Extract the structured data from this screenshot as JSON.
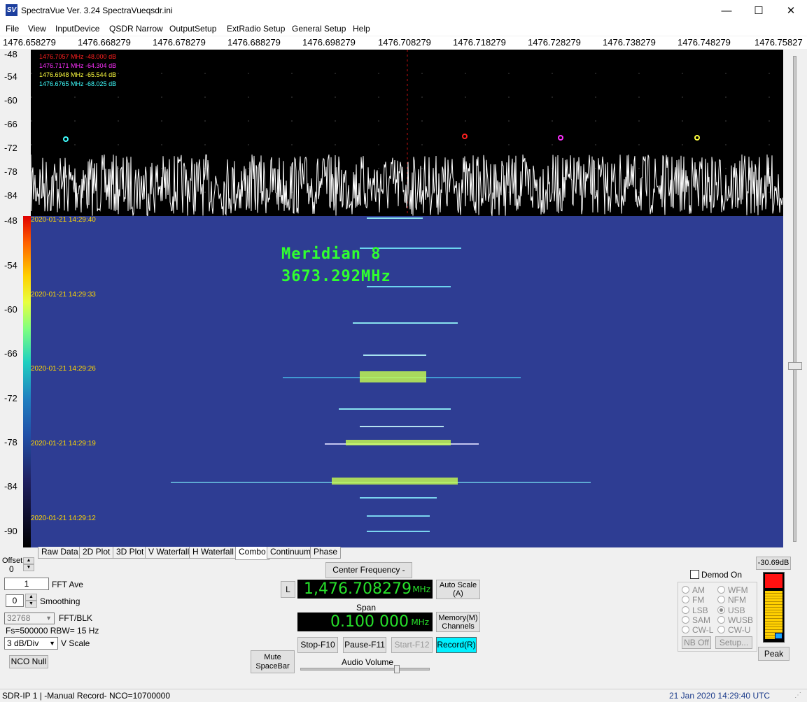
{
  "window": {
    "icon_text": "SV",
    "title": "SpectraVue Ver. 3.24  SpectraVueqsdr.ini",
    "minimize": "—",
    "maximize": "☐",
    "close": "✕"
  },
  "menu": [
    "File",
    "View",
    "InputDevice",
    "QSDR Narrow",
    "OutputSetup",
    "ExtRadio Setup",
    "General Setup",
    "Help"
  ],
  "freq_scale": [
    "1476.658279",
    "1476.668279",
    "1476.678279",
    "1476.688279",
    "1476.698279",
    "1476.708279",
    "1476.718279",
    "1476.728279",
    "1476.738279",
    "1476.748279",
    "1476.75827"
  ],
  "spectrum": {
    "y_labels": [
      "-48",
      "-54",
      "-60",
      "-66",
      "-72",
      "-78",
      "-84"
    ],
    "markers": [
      {
        "text": "1476.7057 MHz -48.000 dB",
        "color": "#ff2020"
      },
      {
        "text": "1476.7171 MHz -64.304 dB",
        "color": "#ff30ff"
      },
      {
        "text": "1476.6948 MHz -65.544 dB",
        "color": "#ffff40"
      },
      {
        "text": "1476.6765 MHz -68.025 dB",
        "color": "#40ffff"
      }
    ]
  },
  "waterfall": {
    "y_labels": [
      "-48",
      "-54",
      "-60",
      "-66",
      "-72",
      "-78",
      "-84",
      "-90"
    ],
    "timestamps": [
      "2020-01-21 14:29:40",
      "2020-01-21 14:29:33",
      "2020-01-21 14:29:26",
      "2020-01-21 14:29:19",
      "2020-01-21 14:29:12"
    ],
    "overlay_line1": "Meridian 8",
    "overlay_line2": "3673.292MHz"
  },
  "tabs": [
    "Raw Data",
    "2D Plot",
    "3D Plot",
    "V Waterfall",
    "H Waterfall",
    "Combo",
    "Continuum",
    "Phase"
  ],
  "controls": {
    "offset_label": "Offset",
    "offset_value": "0",
    "fft_ave_value": "1",
    "fft_ave_label": "FFT Ave",
    "smoothing_value": "0",
    "smoothing_label": "Smoothing",
    "fft_blk_value": "32768",
    "fft_blk_label": "FFT/BLK",
    "fs_info": "Fs=500000 RBW= 15 Hz",
    "vscale_value": "3 dB/Div",
    "vscale_label": "V Scale",
    "nco_null": "NCO Null",
    "center_freq_button": "Center Frequency - Ins",
    "l_button": "L",
    "center_freq_value": "1,476.708279",
    "mhz_unit": "MHz",
    "span_label": "Span",
    "span_value": "0.100 000",
    "auto_scale": "Auto Scale\n(A)",
    "memory_channels": "Memory(M)\nChannels",
    "stop": "Stop-F10",
    "pause": "Pause-F11",
    "start": "Start-F12",
    "record": "Record(R)",
    "mute": "Mute\nSpaceBar",
    "audio_volume": "Audio Volume",
    "level_readout": "-30.69dB",
    "demod_on": "Demod On",
    "modes_left": [
      "AM",
      "FM",
      "LSB",
      "SAM",
      "CW-L"
    ],
    "modes_right": [
      "WFM",
      "NFM",
      "USB",
      "WUSB",
      "CW-U"
    ],
    "selected_mode": "USB",
    "nb_off": "NB Off",
    "setup": "Setup...",
    "peak": "Peak"
  },
  "status": {
    "left": "SDR-IP 1  | -Manual Record-   NCO=10700000",
    "right": "21 Jan 2020  14:29:40 UTC"
  },
  "colors": {
    "lcd_green": "#26e02a",
    "record_cyan": "#00f0ff",
    "waterfall_bg": "#2e3d93"
  }
}
